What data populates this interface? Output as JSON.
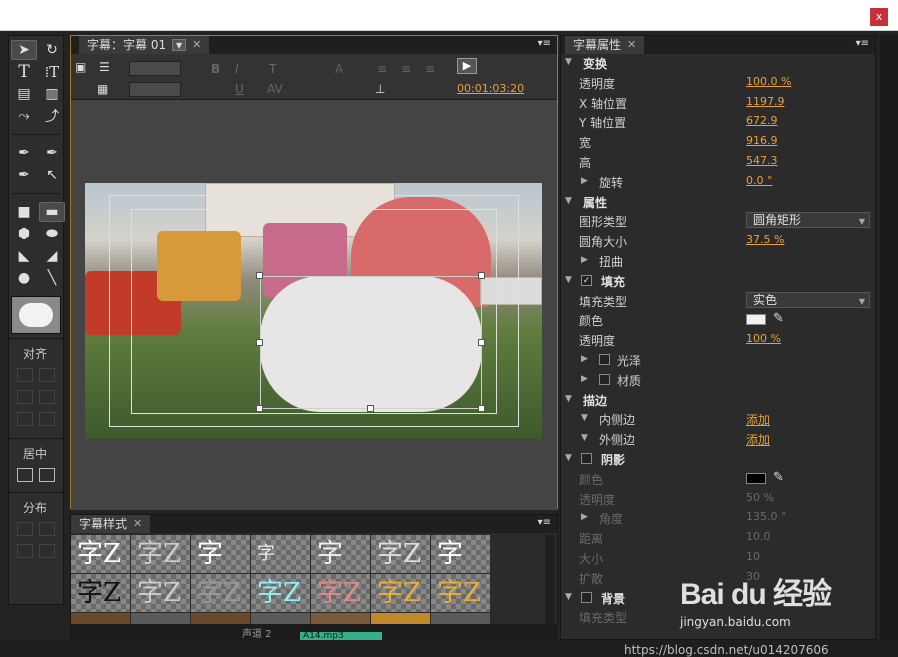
{
  "window": {
    "close_label": "x"
  },
  "tools": {
    "align_label": "对齐",
    "center_label": "居中",
    "distribute_label": "分布"
  },
  "title_panel": {
    "tab_label": "字幕：字幕 01",
    "timecode": "00:01:03:20"
  },
  "styles_panel": {
    "tab_label": "字幕样式",
    "swatches": [
      "字Z",
      "字Z",
      "字",
      "字",
      "字",
      "字Z",
      "字",
      "字Z",
      "字Z",
      "字Z",
      "字Z",
      "字Z",
      "字Z",
      "字Z"
    ]
  },
  "props": {
    "tab_label": "字幕属性",
    "transform": {
      "label": "变换",
      "opacity_label": "透明度",
      "opacity": "100.0 %",
      "x_label": "X 轴位置",
      "x": "1197.9",
      "y_label": "Y 轴位置",
      "y": "672.9",
      "width_label": "宽",
      "width": "916.9",
      "height_label": "高",
      "height": "547.3",
      "rotation_label": "旋转",
      "rotation": "0.0 °"
    },
    "properties": {
      "label": "属性",
      "shape_type_label": "图形类型",
      "shape_type": "圆角矩形",
      "corner_label": "圆角大小",
      "corner": "37.5 %",
      "distort_label": "扭曲"
    },
    "fill": {
      "label": "填充",
      "fill_type_label": "填充类型",
      "fill_type": "实色",
      "color_label": "颜色",
      "color": "#f0f0f0",
      "opacity_label": "透明度",
      "opacity": "100 %",
      "sheen_label": "光泽",
      "texture_label": "材质"
    },
    "strokes": {
      "label": "描边",
      "inner_label": "内侧边",
      "inner_add": "添加",
      "outer_label": "外侧边",
      "outer_add": "添加"
    },
    "shadow": {
      "label": "阴影",
      "color_label": "颜色",
      "color": "#000000",
      "opacity_label": "透明度",
      "opacity": "50 %",
      "angle_label": "角度",
      "angle": "135.0 °",
      "distance_label": "距离",
      "distance": "10.0",
      "size_label": "大小",
      "size": "10",
      "spread_label": "扩散",
      "spread": "30"
    },
    "background": {
      "label": "背景",
      "fill_type_label": "填充类型"
    }
  },
  "bottom": {
    "clip_label": "A14.mp3",
    "track_label": "声道 2"
  },
  "watermark": {
    "logo": "Bai du 经验",
    "site": "jingyan.baidu.com",
    "url": "https://blog.csdn.net/u014207606"
  }
}
